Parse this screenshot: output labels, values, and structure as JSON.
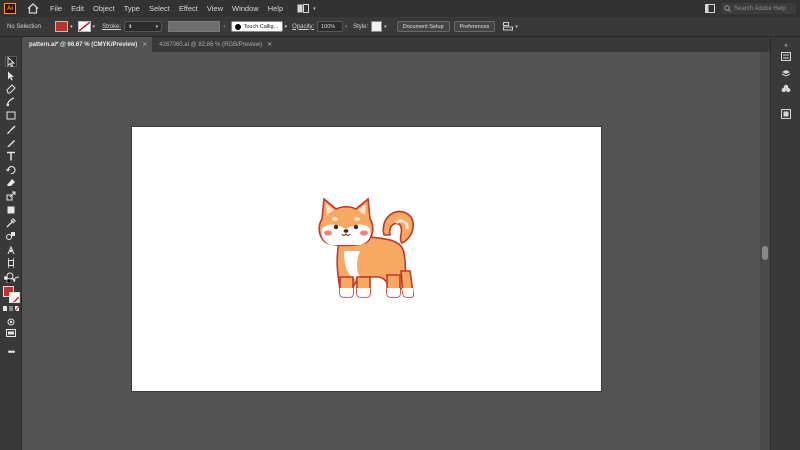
{
  "app": {
    "logo_text": "Ai",
    "accent": "#ff9a00"
  },
  "menu": [
    "File",
    "Edit",
    "Object",
    "Type",
    "Select",
    "Effect",
    "View",
    "Window",
    "Help"
  ],
  "search": {
    "placeholder": "Search Adobe Help"
  },
  "control_bar": {
    "selection_label": "No Selection",
    "fill_color": "#b8332e",
    "stroke_label": "Stroke:",
    "brush_name": "Touch Callig...",
    "opacity_label": "Opacity:",
    "opacity_value": "100%",
    "style_label": "Style:",
    "document_setup": "Document Setup",
    "preferences": "Preferences"
  },
  "tabs": [
    {
      "label": "pattern.ai* @ 66.67 % (CMYK/Preview)",
      "active": true
    },
    {
      "label": "4267060.ai @ 82.86 % (RGB/Preview)",
      "active": false
    }
  ],
  "artwork": {
    "subject": "shiba-inu-dog-illustration",
    "fur_color": "#f7a863",
    "outline_color": "#c0392b",
    "blush_color": "#f26b6b"
  },
  "tools": [
    "selection-tool",
    "direct-selection-tool",
    "pen-tool",
    "curvature-tool",
    "rectangle-tool",
    "paintbrush-tool",
    "pencil-tool",
    "type-tool",
    "rotate-tool",
    "eraser-tool",
    "scale-tool",
    "width-tool",
    "free-transform-tool",
    "shape-builder-tool",
    "eyedropper-tool",
    "blend-tool",
    "symbol-sprayer-tool",
    "artboard-tool",
    "zoom-tool"
  ]
}
